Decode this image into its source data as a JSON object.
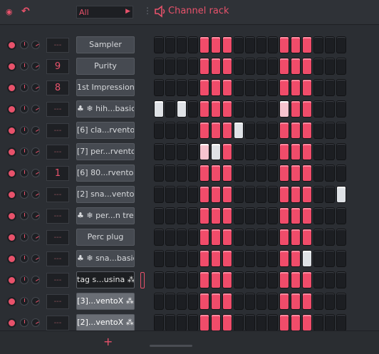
{
  "toolbar": {
    "menu_icon": "menu-arrow-icon",
    "undo_icon": "undo-icon",
    "filter_value": "All",
    "title": "Channel rack"
  },
  "channels": [
    {
      "name": "Sampler",
      "route": "---",
      "style": "normal",
      "steps": "................",
      "fx": false
    },
    {
      "name": "Purity",
      "route": "9",
      "style": "normal",
      "steps": "................",
      "fx": false
    },
    {
      "name": "1st Impression",
      "route": "8",
      "style": "normal",
      "steps": "................",
      "fx": false
    },
    {
      "name": "♣ ❄ hih...basic",
      "route": "---",
      "style": "normal",
      "steps": "................",
      "fx": false
    },
    {
      "name": "[6] cla...rventoX",
      "route": "---",
      "style": "normal",
      "steps": "................",
      "fx": false
    },
    {
      "name": "[7] per...rventoX",
      "route": "---",
      "style": "normal",
      "steps": "................",
      "fx": false
    },
    {
      "name": "[6] 80...rventoX",
      "route": "1",
      "style": "normal",
      "steps": "................",
      "fx": false
    },
    {
      "name": "[2] sna...ventoX",
      "route": "---",
      "style": "normal",
      "steps": "................",
      "fx": false
    },
    {
      "name": "♣ ❄ per...n tree",
      "route": "---",
      "style": "normal",
      "steps": "................",
      "fx": false
    },
    {
      "name": "Perc plug",
      "route": "---",
      "style": "normal",
      "steps": "................",
      "fx": false
    },
    {
      "name": "♣ ❄ sna...basic",
      "route": "---",
      "style": "normal",
      "steps": "................",
      "fx": false
    },
    {
      "name": "tag s...usina",
      "route": "---",
      "style": "dark",
      "steps": "................",
      "fx": true
    },
    {
      "name": "[3]...ventoX",
      "route": "---",
      "style": "sel",
      "steps": "................",
      "fx": true
    },
    {
      "name": "[2]...ventoX",
      "route": "---",
      "style": "sel",
      "steps": "................",
      "fx": true
    }
  ],
  "step_patterns": [
    "00001110000111000",
    "00001110000111000",
    "00001110000111000",
    "v0v01110000p11000",
    "0000111v000111000",
    "0000pv10000111000",
    "00001110000111000",
    "0000111000011100v",
    "00001110000111000",
    "00001110000111000",
    "0000111000011v000",
    "00001110000111000",
    "00001110000111000",
    "00001110000111000"
  ],
  "bottom": {
    "add_icon": "plus-icon"
  }
}
